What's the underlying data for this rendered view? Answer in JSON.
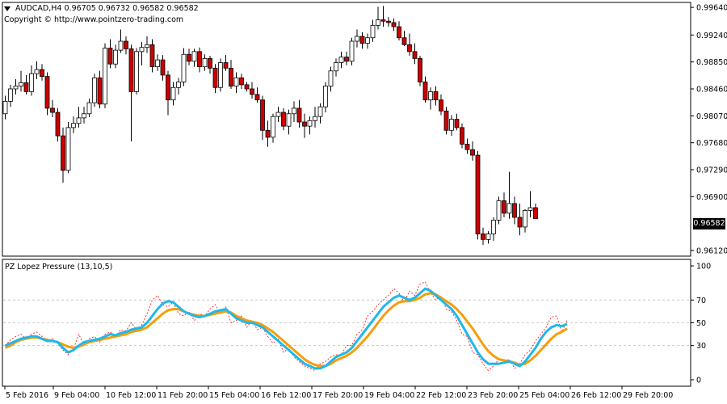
{
  "header": {
    "symbol": "AUDCAD,H4",
    "ohlc": "0.96705 0.96732 0.96582 0.96582",
    "copyright": "Copyright © http://www.pointzero-trading.com"
  },
  "indicator": {
    "label": "PZ Lopez Pressure (13,10,5)"
  },
  "price_tag": "0.96582",
  "colors": {
    "bull": "#ffffff",
    "bear": "#cc0000",
    "fast": "#1fb8ea",
    "slow": "#f59e0b",
    "signal": "#ff0000",
    "grid": "#bdbdbd"
  },
  "chart_data": [
    {
      "type": "candlestick",
      "title": "AUDCAD,H4",
      "ylim": [
        0.9605,
        0.997
      ],
      "y_ticks": [
        "0.99640",
        "0.99240",
        "0.98850",
        "0.98460",
        "0.98070",
        "0.97680",
        "0.97290",
        "0.96900",
        "0.96582",
        "0.96120"
      ],
      "x_ticks": [
        "5 Feb 2016",
        "9 Feb 04:00",
        "10 Feb 12:00",
        "11 Feb 20:00",
        "15 Feb 04:00",
        "16 Feb 12:00",
        "17 Feb 20:00",
        "19 Feb 04:00",
        "22 Feb 12:00",
        "23 Feb 20:00",
        "25 Feb 04:00",
        "26 Feb 12:00",
        "29 Feb 20:00"
      ],
      "candles": [
        [
          0.981,
          0.9836,
          0.9802,
          0.9828
        ],
        [
          0.9828,
          0.9852,
          0.982,
          0.9846
        ],
        [
          0.9846,
          0.986,
          0.9838,
          0.985
        ],
        [
          0.985,
          0.9872,
          0.9842,
          0.9855
        ],
        [
          0.9855,
          0.9866,
          0.9838,
          0.9842
        ],
        [
          0.9842,
          0.988,
          0.9836,
          0.9868
        ],
        [
          0.9868,
          0.9886,
          0.986,
          0.9874
        ],
        [
          0.9874,
          0.9882,
          0.9858,
          0.9864
        ],
        [
          0.9864,
          0.987,
          0.9808,
          0.9818
        ],
        [
          0.9818,
          0.983,
          0.9805,
          0.9812
        ],
        [
          0.9812,
          0.9818,
          0.977,
          0.9778
        ],
        [
          0.9778,
          0.979,
          0.971,
          0.9728
        ],
        [
          0.9728,
          0.9798,
          0.9724,
          0.979
        ],
        [
          0.979,
          0.9806,
          0.9782,
          0.9796
        ],
        [
          0.9796,
          0.982,
          0.979,
          0.9804
        ],
        [
          0.9804,
          0.982,
          0.9796,
          0.981
        ],
        [
          0.981,
          0.9832,
          0.9805,
          0.9826
        ],
        [
          0.9826,
          0.9868,
          0.982,
          0.9862
        ],
        [
          0.9862,
          0.9872,
          0.9818,
          0.9824
        ],
        [
          0.9824,
          0.9912,
          0.9818,
          0.9905
        ],
        [
          0.9905,
          0.9918,
          0.9876,
          0.9882
        ],
        [
          0.9882,
          0.991,
          0.9876,
          0.9902
        ],
        [
          0.9902,
          0.9932,
          0.9898,
          0.9915
        ],
        [
          0.9915,
          0.9922,
          0.9896,
          0.9904
        ],
        [
          0.9904,
          0.991,
          0.977,
          0.9842
        ],
        [
          0.9842,
          0.9905,
          0.9838,
          0.99
        ],
        [
          0.99,
          0.9914,
          0.988,
          0.9906
        ],
        [
          0.9906,
          0.9922,
          0.9898,
          0.991
        ],
        [
          0.991,
          0.9918,
          0.987,
          0.9878
        ],
        [
          0.9878,
          0.9896,
          0.9872,
          0.9888
        ],
        [
          0.9888,
          0.9895,
          0.9858,
          0.9866
        ],
        [
          0.9866,
          0.9872,
          0.9808,
          0.983
        ],
        [
          0.983,
          0.9856,
          0.9822,
          0.9848
        ],
        [
          0.9848,
          0.9862,
          0.9838,
          0.9856
        ],
        [
          0.9856,
          0.9905,
          0.985,
          0.9896
        ],
        [
          0.9896,
          0.9904,
          0.988,
          0.9886
        ],
        [
          0.9886,
          0.9904,
          0.9878,
          0.99
        ],
        [
          0.99,
          0.9906,
          0.987,
          0.9878
        ],
        [
          0.9878,
          0.9896,
          0.9872,
          0.989
        ],
        [
          0.989,
          0.9894,
          0.9868,
          0.9876
        ],
        [
          0.9876,
          0.9882,
          0.984,
          0.9848
        ],
        [
          0.9848,
          0.989,
          0.9842,
          0.9884
        ],
        [
          0.9884,
          0.9895,
          0.9872,
          0.9876
        ],
        [
          0.9876,
          0.9888,
          0.9846,
          0.985
        ],
        [
          0.985,
          0.987,
          0.984,
          0.9862
        ],
        [
          0.9862,
          0.9868,
          0.9846,
          0.9852
        ],
        [
          0.9852,
          0.9856,
          0.9842,
          0.9846
        ],
        [
          0.9846,
          0.9856,
          0.9832,
          0.9838
        ],
        [
          0.9838,
          0.9848,
          0.9826,
          0.983
        ],
        [
          0.983,
          0.9836,
          0.9772,
          0.9786
        ],
        [
          0.9786,
          0.98,
          0.9762,
          0.9776
        ],
        [
          0.9776,
          0.981,
          0.9768,
          0.9806
        ],
        [
          0.9806,
          0.982,
          0.9798,
          0.9812
        ],
        [
          0.9812,
          0.9818,
          0.9786,
          0.9792
        ],
        [
          0.9792,
          0.9816,
          0.978,
          0.981
        ],
        [
          0.981,
          0.9828,
          0.9798,
          0.9818
        ],
        [
          0.9818,
          0.983,
          0.979,
          0.9798
        ],
        [
          0.9798,
          0.981,
          0.9775,
          0.9792
        ],
        [
          0.9792,
          0.9806,
          0.978,
          0.98
        ],
        [
          0.98,
          0.982,
          0.979,
          0.9806
        ],
        [
          0.9806,
          0.9825,
          0.9796,
          0.982
        ],
        [
          0.982,
          0.9856,
          0.9812,
          0.985
        ],
        [
          0.985,
          0.9878,
          0.9842,
          0.9872
        ],
        [
          0.9872,
          0.989,
          0.9864,
          0.9884
        ],
        [
          0.9884,
          0.99,
          0.9876,
          0.9892
        ],
        [
          0.9892,
          0.99,
          0.988,
          0.9886
        ],
        [
          0.9886,
          0.992,
          0.988,
          0.9915
        ],
        [
          0.9915,
          0.9932,
          0.9906,
          0.9922
        ],
        [
          0.9922,
          0.9928,
          0.9904,
          0.9912
        ],
        [
          0.9912,
          0.9926,
          0.9904,
          0.992
        ],
        [
          0.992,
          0.9946,
          0.9914,
          0.9938
        ],
        [
          0.9938,
          0.9965,
          0.9932,
          0.9946
        ],
        [
          0.9946,
          0.9966,
          0.9936,
          0.9944
        ],
        [
          0.9944,
          0.995,
          0.9936,
          0.9942
        ],
        [
          0.9942,
          0.9948,
          0.993,
          0.9936
        ],
        [
          0.9936,
          0.9944,
          0.9916,
          0.992
        ],
        [
          0.992,
          0.993,
          0.9908,
          0.991
        ],
        [
          0.991,
          0.9926,
          0.9894,
          0.99
        ],
        [
          0.99,
          0.9912,
          0.9882,
          0.989
        ],
        [
          0.989,
          0.9894,
          0.985,
          0.9856
        ],
        [
          0.9856,
          0.9864,
          0.9826,
          0.983
        ],
        [
          0.983,
          0.9848,
          0.9816,
          0.9842
        ],
        [
          0.9842,
          0.985,
          0.9822,
          0.983
        ],
        [
          0.983,
          0.9838,
          0.9808,
          0.9814
        ],
        [
          0.9814,
          0.982,
          0.978,
          0.9786
        ],
        [
          0.9786,
          0.9808,
          0.9778,
          0.9802
        ],
        [
          0.9802,
          0.981,
          0.9786,
          0.979
        ],
        [
          0.979,
          0.9796,
          0.976,
          0.9766
        ],
        [
          0.9766,
          0.9774,
          0.9752,
          0.9758
        ],
        [
          0.9758,
          0.977,
          0.9742,
          0.975
        ],
        [
          0.975,
          0.9756,
          0.9628,
          0.9636
        ],
        [
          0.9636,
          0.9645,
          0.962,
          0.9628
        ],
        [
          0.9628,
          0.964,
          0.9622,
          0.9636
        ],
        [
          0.9636,
          0.966,
          0.9626,
          0.9656
        ],
        [
          0.9656,
          0.969,
          0.965,
          0.9684
        ],
        [
          0.9684,
          0.9696,
          0.966,
          0.9666
        ],
        [
          0.9666,
          0.9726,
          0.9658,
          0.968
        ],
        [
          0.968,
          0.969,
          0.965,
          0.966
        ],
        [
          0.966,
          0.968,
          0.9634,
          0.9646
        ],
        [
          0.9646,
          0.9672,
          0.9638,
          0.967
        ],
        [
          0.967,
          0.9698,
          0.966,
          0.9674
        ],
        [
          0.9674,
          0.968,
          0.966,
          0.9658
        ]
      ]
    },
    {
      "type": "line",
      "title": "PZ Lopez Pressure (13,10,5)",
      "ylim": [
        -5,
        105
      ],
      "y_ticks": [
        100,
        70,
        50,
        30,
        0
      ],
      "grid_levels": [
        70,
        50,
        30
      ],
      "series": [
        {
          "values": [
            30,
            32,
            34,
            36,
            37,
            38,
            38,
            36,
            34,
            34,
            33,
            28,
            24,
            26,
            30,
            33,
            34,
            35,
            36,
            38,
            40,
            39,
            41,
            42,
            44,
            45,
            46,
            50,
            56,
            62,
            67,
            69,
            68,
            64,
            60,
            58,
            56,
            55,
            56,
            58,
            60,
            61,
            62,
            58,
            54,
            52,
            50,
            50,
            48,
            46,
            42,
            38,
            34,
            30,
            26,
            22,
            18,
            14,
            12,
            10,
            10,
            12,
            16,
            20,
            22,
            24,
            28,
            34,
            40,
            46,
            52,
            58,
            64,
            68,
            72,
            74,
            72,
            70,
            72,
            76,
            80,
            78,
            74,
            70,
            66,
            62,
            56,
            48,
            40,
            32,
            24,
            18,
            14,
            14,
            14,
            15,
            16,
            14,
            12,
            16,
            22,
            28,
            36,
            42,
            46,
            48,
            47,
            49
          ]
        },
        {
          "values": [
            28,
            30,
            33,
            35,
            36,
            37,
            37,
            36,
            35,
            34,
            33,
            31,
            29,
            28,
            29,
            31,
            33,
            34,
            35,
            36,
            37,
            38,
            39,
            40,
            42,
            43,
            44,
            46,
            50,
            54,
            58,
            61,
            62,
            62,
            60,
            58,
            57,
            56,
            56,
            57,
            58,
            59,
            60,
            59,
            56,
            54,
            52,
            51,
            50,
            48,
            45,
            42,
            38,
            34,
            30,
            26,
            22,
            18,
            15,
            13,
            12,
            12,
            14,
            17,
            19,
            21,
            24,
            28,
            33,
            38,
            44,
            50,
            56,
            61,
            65,
            68,
            69,
            69,
            70,
            72,
            75,
            76,
            75,
            72,
            69,
            66,
            62,
            57,
            51,
            45,
            38,
            31,
            25,
            21,
            18,
            17,
            16,
            15,
            13,
            14,
            17,
            21,
            26,
            31,
            36,
            40,
            42,
            45
          ]
        },
        {
          "values": [
            30,
            35,
            38,
            40,
            36,
            40,
            42,
            38,
            34,
            36,
            32,
            26,
            22,
            27,
            40,
            30,
            36,
            38,
            33,
            40,
            42,
            38,
            44,
            43,
            50,
            44,
            48,
            58,
            70,
            74,
            66,
            64,
            68,
            58,
            56,
            60,
            52,
            58,
            56,
            62,
            66,
            58,
            64,
            50,
            52,
            56,
            46,
            52,
            44,
            46,
            38,
            32,
            36,
            24,
            28,
            20,
            16,
            12,
            10,
            8,
            14,
            16,
            20,
            22,
            22,
            30,
            30,
            40,
            44,
            56,
            60,
            66,
            70,
            74,
            80,
            76,
            68,
            78,
            74,
            84,
            86,
            76,
            70,
            74,
            62,
            60,
            52,
            40,
            38,
            24,
            22,
            14,
            8,
            12,
            18,
            16,
            18,
            10,
            14,
            22,
            26,
            34,
            40,
            46,
            55,
            56,
            42,
            52
          ]
        }
      ]
    }
  ]
}
